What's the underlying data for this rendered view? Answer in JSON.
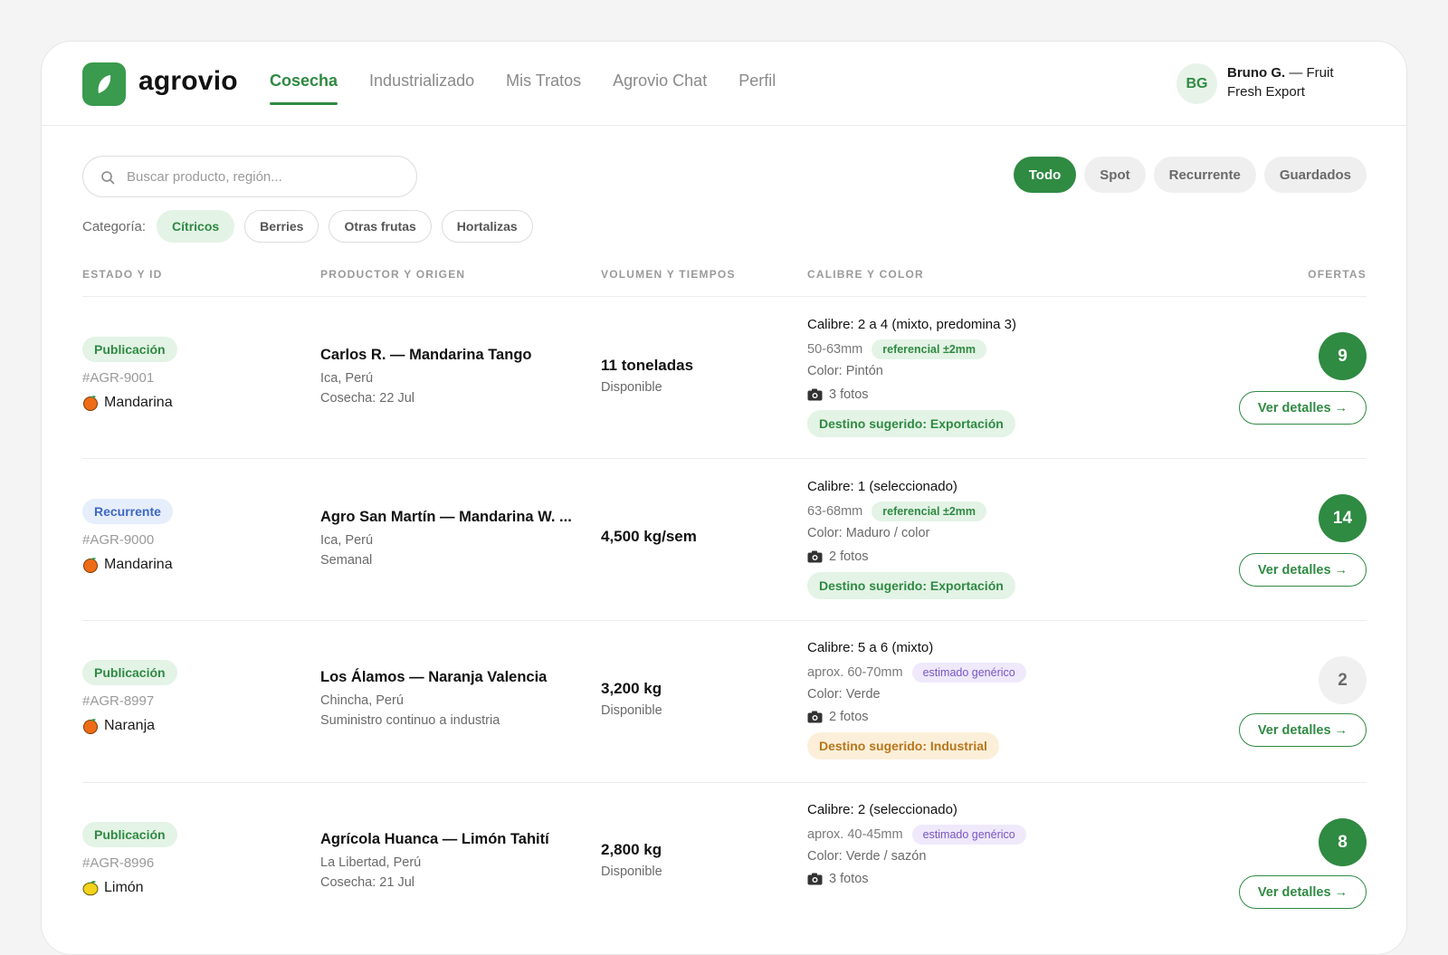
{
  "brand": {
    "name": "agrovio",
    "icon": "leaf-icon",
    "accent": "#2f8a42"
  },
  "nav": {
    "items": [
      {
        "label": "Cosecha",
        "active": true
      },
      {
        "label": "Industrializado",
        "active": false
      },
      {
        "label": "Mis Tratos",
        "active": false
      },
      {
        "label": "Agrovio Chat",
        "active": false
      },
      {
        "label": "Perfil",
        "active": false
      }
    ]
  },
  "user": {
    "initials": "BG",
    "name": "Bruno G.",
    "company": "— Fruit Fresh Export"
  },
  "search": {
    "placeholder": "Buscar producto, región...",
    "value": "",
    "icon": "search-icon"
  },
  "filters": {
    "segments": [
      {
        "label": "Todo",
        "active": true
      },
      {
        "label": "Spot",
        "active": false
      },
      {
        "label": "Recurrente",
        "active": false
      },
      {
        "label": "Guardados",
        "active": false
      }
    ],
    "category_label": "Categoría:",
    "categories": [
      {
        "label": "Cítricos",
        "active": true
      },
      {
        "label": "Berries",
        "active": false
      },
      {
        "label": "Otras frutas",
        "active": false
      },
      {
        "label": "Hortalizas",
        "active": false
      }
    ]
  },
  "table": {
    "headers": {
      "status": "ESTADO Y ID",
      "producer": "PRODUCTOR Y ORIGEN",
      "volume": "VOLUMEN Y TIEMPOS",
      "caliber": "CALIBRE Y COLOR",
      "offers": "OFERTAS"
    },
    "rows": [
      {
        "status": "Publicación",
        "status_kind": "pub",
        "id": "#AGR-9001",
        "fruit": "Mandarina",
        "fruit_icon": "orange-icon",
        "title": "Carlos R. — Mandarina Tango",
        "origin": "Ica, Perú",
        "detail": "Cosecha: 22 Jul",
        "volume": "11 toneladas",
        "volume_sub": "Disponible",
        "caliber": "Calibre: 2 a 4 (mixto, predomina 3)",
        "size": "50-63mm",
        "size_tag": "referencial ±2mm",
        "size_tag_kind": "ref",
        "color": "Color: Pintón",
        "photos": "3 fotos",
        "destination": "Destino sugerido: Exportación",
        "destination_kind": "exp",
        "offers": "9",
        "offers_kind": "green",
        "button": "Ver detalles →"
      },
      {
        "status": "Recurrente",
        "status_kind": "rec",
        "id": "#AGR-9000",
        "fruit": "Mandarina",
        "fruit_icon": "orange-icon",
        "title": "Agro San Martín — Mandarina W. ...",
        "origin": "Ica, Perú",
        "detail": "Semanal",
        "volume": "4,500 kg/sem",
        "volume_sub": "",
        "caliber": "Calibre: 1 (seleccionado)",
        "size": "63-68mm",
        "size_tag": "referencial ±2mm",
        "size_tag_kind": "ref",
        "color": "Color: Maduro / color",
        "photos": "2 fotos",
        "destination": "Destino sugerido: Exportación",
        "destination_kind": "exp",
        "offers": "14",
        "offers_kind": "green",
        "button": "Ver detalles →"
      },
      {
        "status": "Publicación",
        "status_kind": "pub",
        "id": "#AGR-8997",
        "fruit": "Naranja",
        "fruit_icon": "orange-icon",
        "title": "Los Álamos — Naranja Valencia",
        "origin": "Chincha, Perú",
        "detail": "Suministro continuo a industria",
        "volume": "3,200 kg",
        "volume_sub": "Disponible",
        "caliber": "Calibre: 5 a 6 (mixto)",
        "size": "aprox. 60-70mm",
        "size_tag": "estimado genérico",
        "size_tag_kind": "est",
        "color": "Color: Verde",
        "photos": "2 fotos",
        "destination": "Destino sugerido: Industrial",
        "destination_kind": "ind",
        "offers": "2",
        "offers_kind": "grey",
        "button": "Ver detalles →"
      },
      {
        "status": "Publicación",
        "status_kind": "pub",
        "id": "#AGR-8996",
        "fruit": "Limón",
        "fruit_icon": "lemon-icon",
        "title": "Agrícola Huanca — Limón Tahití",
        "origin": "La Libertad, Perú",
        "detail": "Cosecha: 21 Jul",
        "volume": "2,800 kg",
        "volume_sub": "Disponible",
        "caliber": "Calibre: 2 (seleccionado)",
        "size": "aprox. 40-45mm",
        "size_tag": "estimado genérico",
        "size_tag_kind": "est",
        "color": "Color: Verde / sazón",
        "photos": "3 fotos",
        "destination": "",
        "destination_kind": "exp",
        "offers": "8",
        "offers_kind": "green",
        "button": "Ver detalles →"
      }
    ]
  }
}
